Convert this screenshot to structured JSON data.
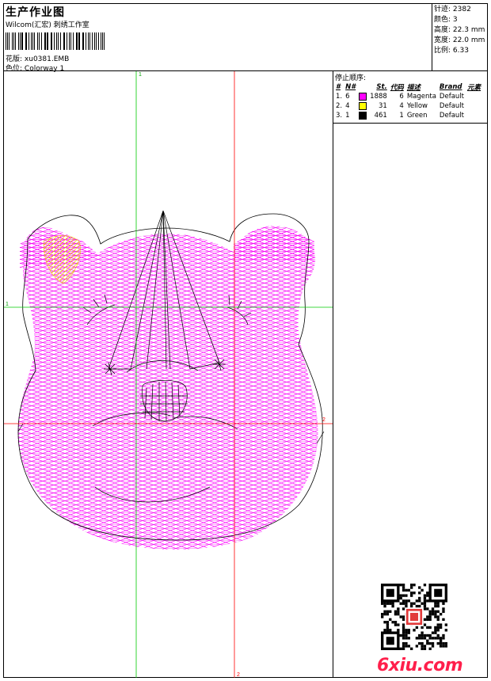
{
  "header": {
    "title": "生产作业图",
    "subtitle": "Wilcom(汇宏) 刺绣工作室",
    "design_label": "花版:",
    "design_value": "xu0381.EMB",
    "colorway_label": "色位:",
    "colorway_value": "Colorway 1"
  },
  "stats": {
    "stitches_label": "针迹:",
    "stitches_value": "2382",
    "colors_label": "颜色:",
    "colors_value": "3",
    "height_label": "高度:",
    "height_value": "22.3 mm",
    "width_label": "宽度:",
    "width_value": "22.0 mm",
    "scale_label": "比例:",
    "scale_value": "6.33"
  },
  "sequence": {
    "title": "停止顺序:",
    "columns": [
      "#",
      "N#",
      "St.",
      "代码",
      "描述",
      "Brand",
      "元素"
    ],
    "rows": [
      {
        "num": "1.",
        "n": "6",
        "color": "#ff00ff",
        "st": "1888",
        "code": "6",
        "desc": "Magenta",
        "brand": "Default"
      },
      {
        "num": "2.",
        "n": "4",
        "color": "#ffff00",
        "st": "31",
        "code": "4",
        "desc": "Yellow",
        "brand": "Default"
      },
      {
        "num": "3.",
        "n": "1",
        "color": "#000000",
        "st": "461",
        "code": "1",
        "desc": "Green",
        "brand": "Default"
      }
    ]
  },
  "axes": {
    "v_green": "1",
    "h_green": "1",
    "h_red": "2",
    "v_red": "2"
  },
  "watermark": {
    "site": "6xiu.com"
  },
  "colors": {
    "magenta": "#ff00ff",
    "guide_green": "#00cc00",
    "guide_red": "#ff0000"
  }
}
